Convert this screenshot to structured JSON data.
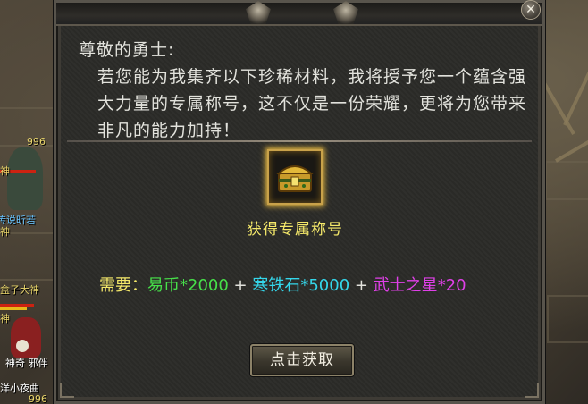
{
  "dialog": {
    "title": "尊敬的勇士:",
    "body": "若您能为我集齐以下珍稀材料，我将授予您一个蕴含强大力量的专属称号，这不仅是一份荣耀，更将为您带来非凡的能力加持！",
    "reward_label": "获得专属称号",
    "requirement": {
      "label": "需要：",
      "items": [
        {
          "name": "易币",
          "qty": "*2000"
        },
        {
          "name": "寒铁石",
          "qty": "*5000"
        },
        {
          "name": "武士之星",
          "qty": "*20"
        }
      ],
      "separator": " + "
    },
    "claim_button": "点击获取",
    "close_glyph": "✕"
  },
  "world_labels": {
    "l1": "996",
    "l2": "传说昕若",
    "l3": "盒子大神",
    "l4": "神",
    "l5": "神",
    "l6": "神",
    "l7": "神奇 邪伴",
    "l8": "洋小夜曲",
    "l9": "996"
  },
  "colors": {
    "yellow": "#f4e86a",
    "green": "#47e04a",
    "cyan": "#34d6ea",
    "magenta": "#e040e8"
  }
}
